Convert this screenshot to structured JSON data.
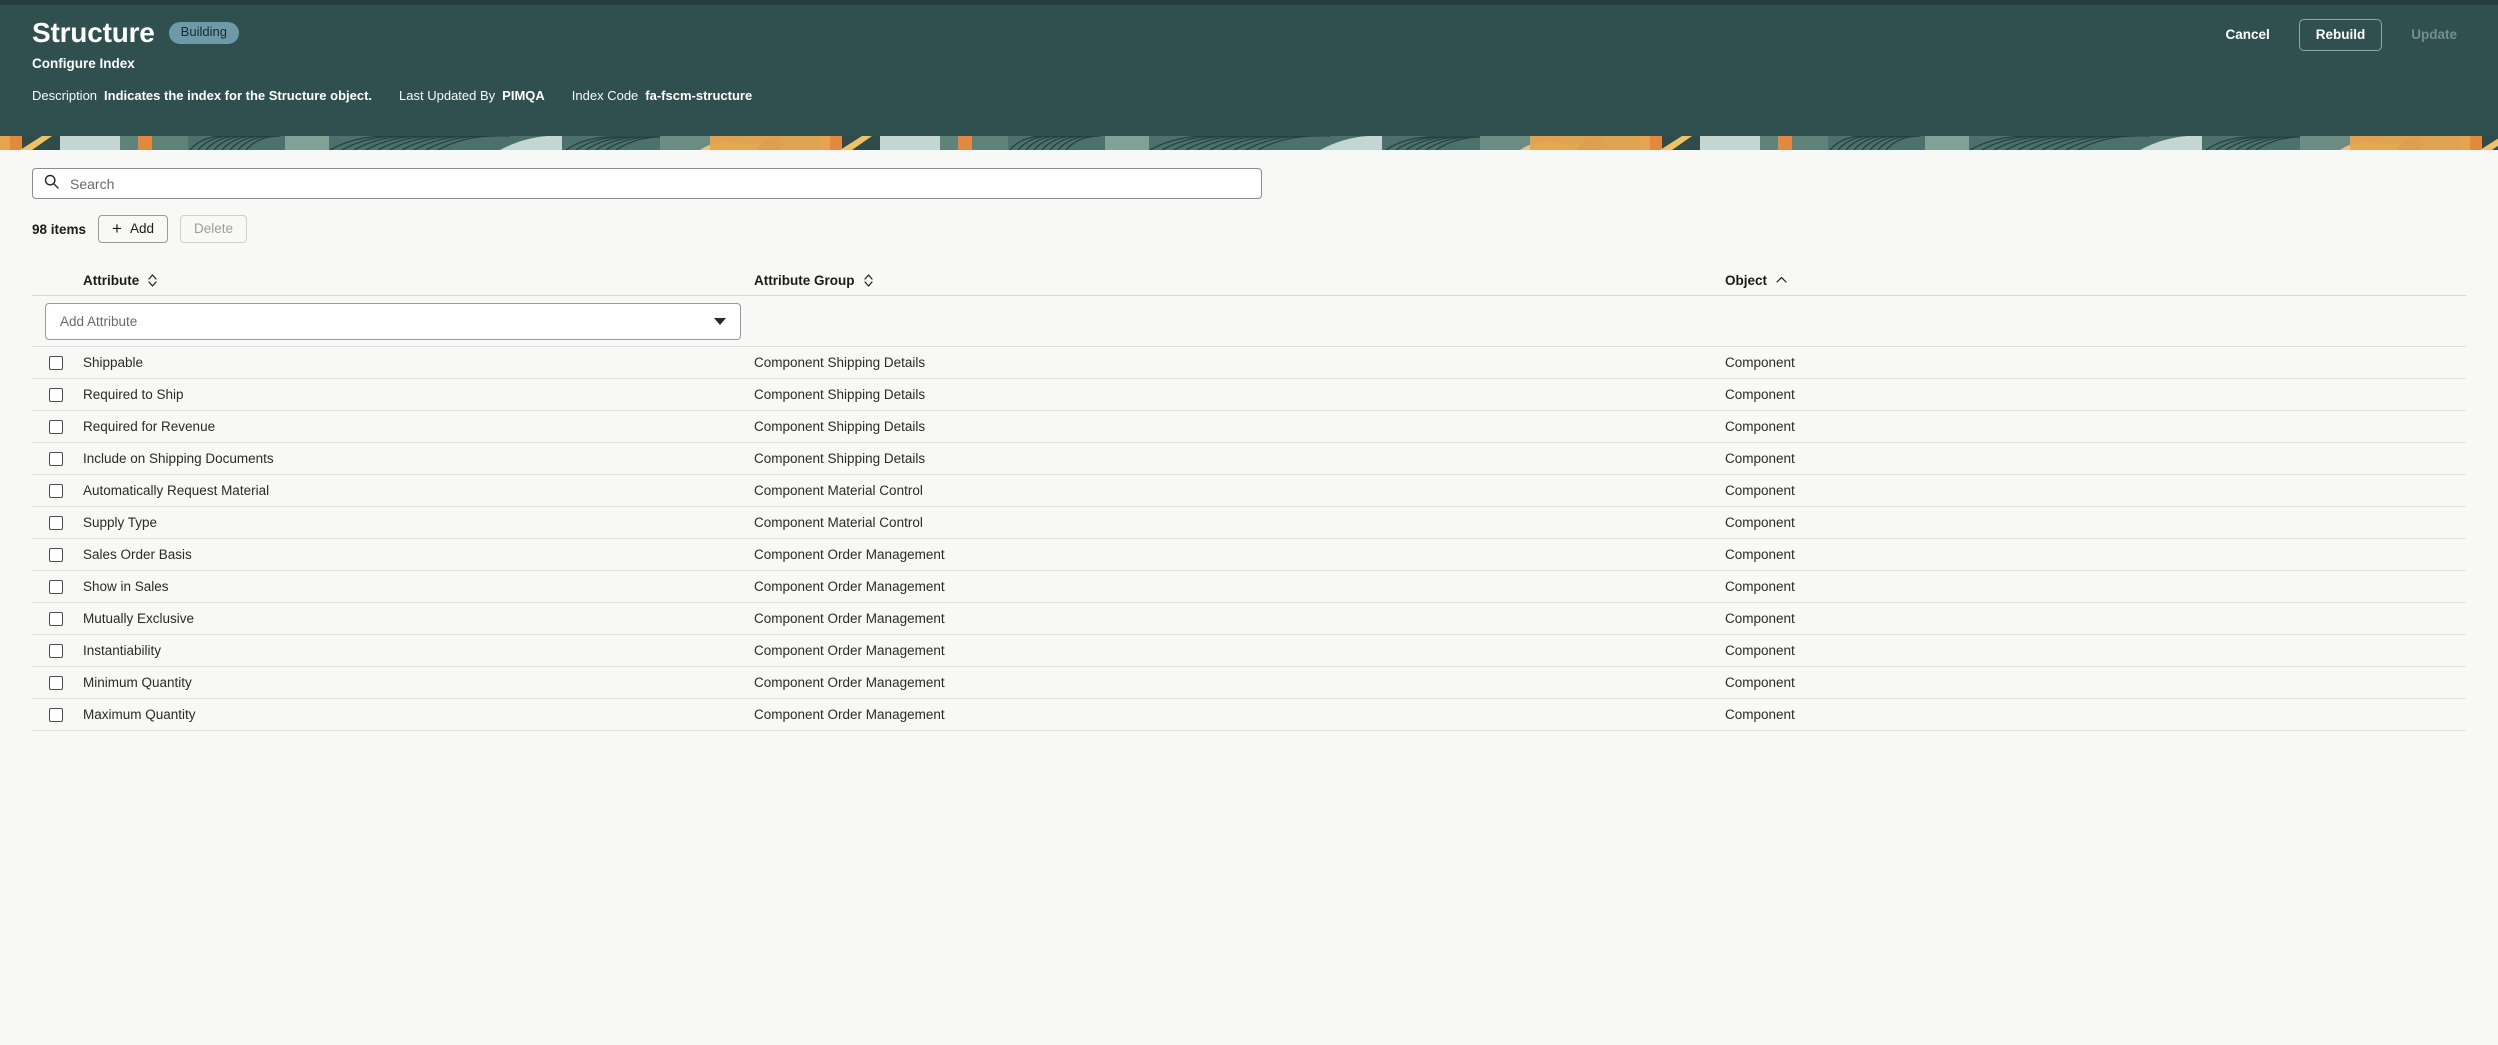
{
  "header": {
    "title": "Structure",
    "status_badge": "Building",
    "subtitle": "Configure Index",
    "meta": [
      {
        "label": "Description",
        "value": "Indicates the index for the Structure object."
      },
      {
        "label": "Last Updated By",
        "value": "PIMQA"
      },
      {
        "label": "Index Code",
        "value": "fa-fscm-structure"
      }
    ],
    "actions": {
      "cancel_label": "Cancel",
      "rebuild_label": "Rebuild",
      "update_label": "Update",
      "update_disabled": true
    },
    "colors": {
      "header_bg": "#30504f",
      "badge_bg": "#6d9aa8",
      "page_bg": "#f8f8f6"
    }
  },
  "search": {
    "placeholder": "Search",
    "value": "",
    "icon": "search-icon"
  },
  "toolbar": {
    "items_count": "98 items",
    "add_label": "Add",
    "delete_label": "Delete",
    "delete_disabled": true
  },
  "table": {
    "columns": [
      {
        "label": "Attribute",
        "sort": "none"
      },
      {
        "label": "Attribute Group",
        "sort": "none"
      },
      {
        "label": "Object",
        "sort": "asc"
      }
    ],
    "add_attribute_placeholder": "Add Attribute",
    "rows": [
      {
        "attribute": "Shippable",
        "group": "Component Shipping Details",
        "object": "Component",
        "checked": false
      },
      {
        "attribute": "Required to Ship",
        "group": "Component Shipping Details",
        "object": "Component",
        "checked": false
      },
      {
        "attribute": "Required for Revenue",
        "group": "Component Shipping Details",
        "object": "Component",
        "checked": false
      },
      {
        "attribute": "Include on Shipping Documents",
        "group": "Component Shipping Details",
        "object": "Component",
        "checked": false
      },
      {
        "attribute": "Automatically Request Material",
        "group": "Component Material Control",
        "object": "Component",
        "checked": false
      },
      {
        "attribute": "Supply Type",
        "group": "Component Material Control",
        "object": "Component",
        "checked": false
      },
      {
        "attribute": "Sales Order Basis",
        "group": "Component Order Management",
        "object": "Component",
        "checked": false
      },
      {
        "attribute": "Show in Sales",
        "group": "Component Order Management",
        "object": "Component",
        "checked": false
      },
      {
        "attribute": "Mutually Exclusive",
        "group": "Component Order Management",
        "object": "Component",
        "checked": false
      },
      {
        "attribute": "Instantiability",
        "group": "Component Order Management",
        "object": "Component",
        "checked": false
      },
      {
        "attribute": "Minimum Quantity",
        "group": "Component Order Management",
        "object": "Component",
        "checked": false
      },
      {
        "attribute": "Maximum Quantity",
        "group": "Component Order Management",
        "object": "Component",
        "checked": false
      }
    ]
  }
}
